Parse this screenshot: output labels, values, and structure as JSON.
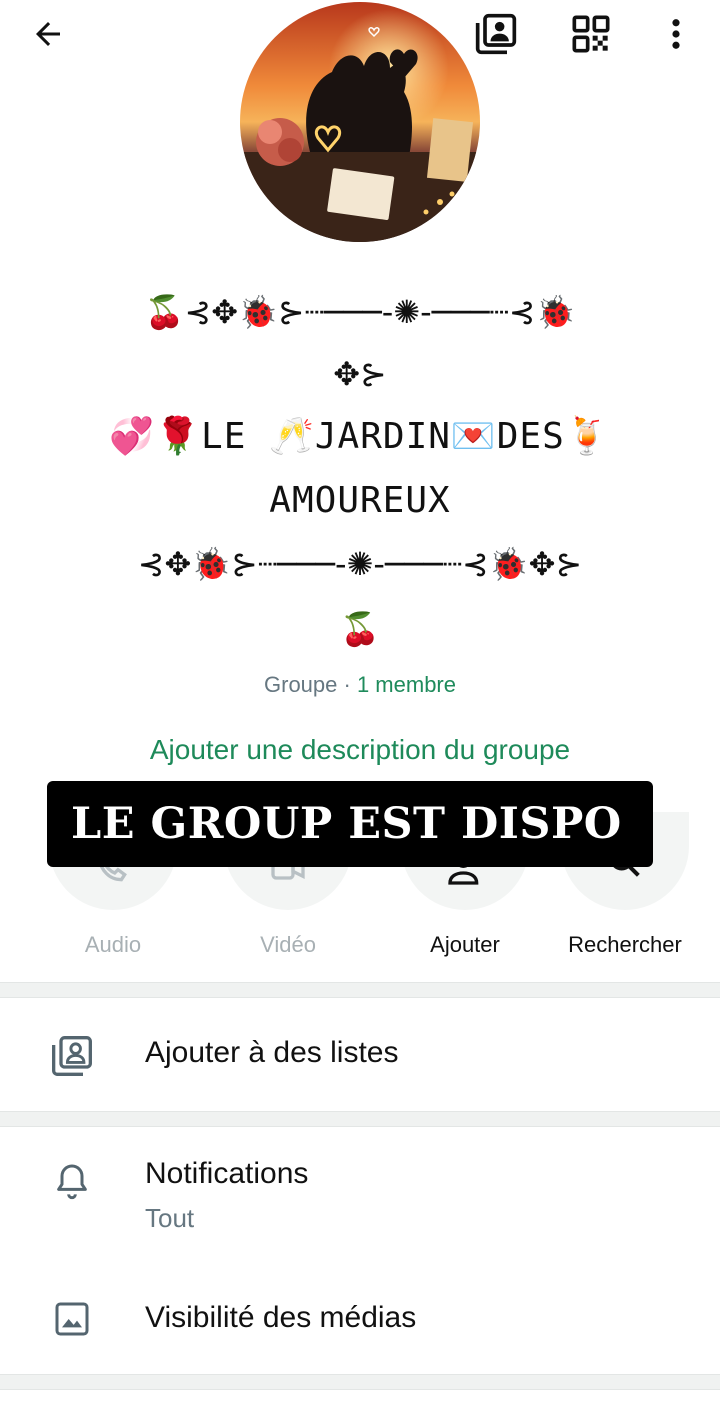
{
  "header": {
    "back_icon": "arrow-left-icon",
    "lists_icon": "contact-lists-icon",
    "qr_icon": "qr-code-icon",
    "more_icon": "more-vertical-icon"
  },
  "group": {
    "name_line1": "🍒⊰✥🐞⊱┈───-✺-───┈⊰🐞",
    "name_line2": "✥⊱",
    "name_line3": "💞🌹LE 🥂JARDIN💌DES🍹",
    "name_line4": "AMOUREUX",
    "name_line5": "⊰✥🐞⊱┈───-✺-───┈⊰🐞✥⊱",
    "name_line6": "🍒",
    "type_label": "Groupe",
    "separator": " · ",
    "members_label": "1 membre",
    "add_description": "Ajouter une description du groupe"
  },
  "overlay": {
    "text": "LE GROUP EST DISPO"
  },
  "actions": [
    {
      "label": "Audio",
      "icon": "phone-icon",
      "enabled": false
    },
    {
      "label": "Vidéo",
      "icon": "video-camera-icon",
      "enabled": false
    },
    {
      "label": "Ajouter",
      "icon": "add-person-icon",
      "enabled": true
    },
    {
      "label": "Rechercher",
      "icon": "search-icon",
      "enabled": true
    }
  ],
  "rows": {
    "lists": {
      "title": "Ajouter à des listes",
      "icon": "contact-lists-icon"
    },
    "notifications": {
      "title": "Notifications",
      "subtitle": "Tout",
      "icon": "bell-icon"
    },
    "media": {
      "title": "Visibilité des médias",
      "icon": "image-icon"
    }
  },
  "colors": {
    "accent": "#1e8a5a",
    "secondary_text": "#667781",
    "disabled_text": "#a8b0b4"
  }
}
